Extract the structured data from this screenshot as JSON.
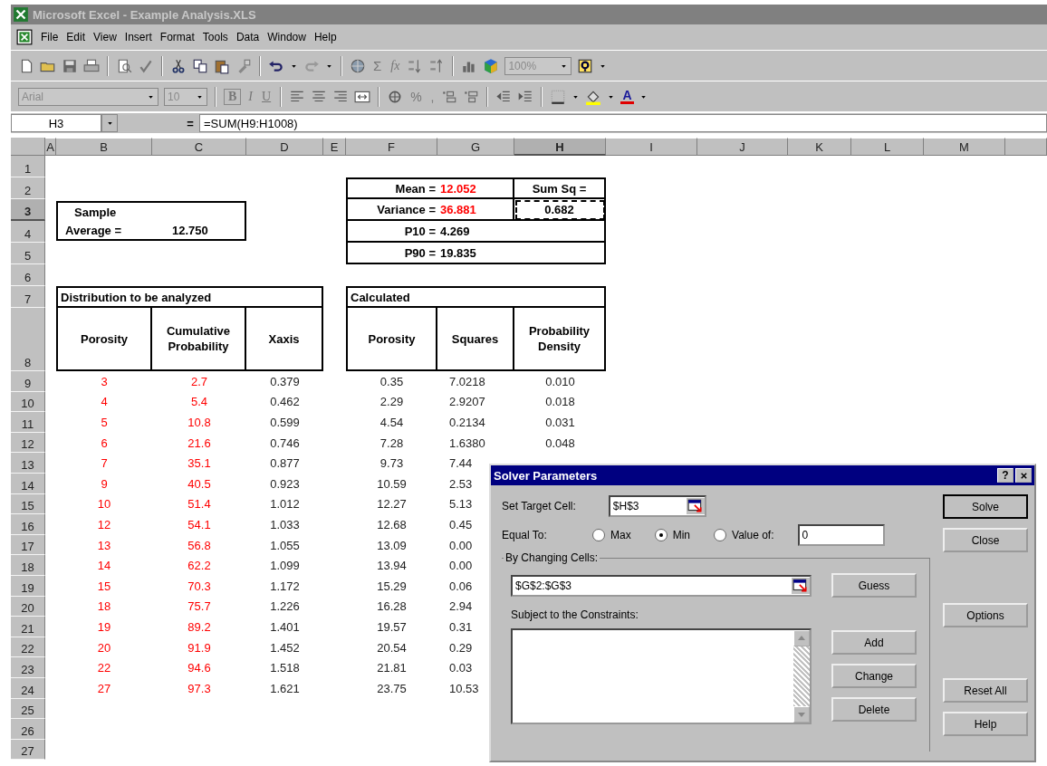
{
  "window": {
    "title": "Microsoft Excel - Example Analysis.XLS"
  },
  "menu": [
    "File",
    "Edit",
    "View",
    "Insert",
    "Format",
    "Tools",
    "Data",
    "Window",
    "Help"
  ],
  "standard_toolbar": {
    "disabled": true,
    "autosum": "Σ",
    "function": "fx",
    "zoom": "100%"
  },
  "formatting_toolbar": {
    "disabled": true,
    "font": "Arial",
    "size": "10",
    "bold": "B",
    "italic": "I",
    "underline": "U",
    "percent": "%",
    "comma": ",",
    "font_color": "A"
  },
  "formula_bar": {
    "name_box": "H3",
    "equals": "=",
    "formula": "=SUM(H9:H1008)"
  },
  "sheet": {
    "columns": [
      {
        "label": "A",
        "selected": false
      },
      {
        "label": "B",
        "selected": false
      },
      {
        "label": "C",
        "selected": false
      },
      {
        "label": "D",
        "selected": false
      },
      {
        "label": "E",
        "selected": false
      },
      {
        "label": "F",
        "selected": false
      },
      {
        "label": "G",
        "selected": false
      },
      {
        "label": "H",
        "selected": true
      },
      {
        "label": "I",
        "selected": false
      },
      {
        "label": "J",
        "selected": false
      },
      {
        "label": "K",
        "selected": false
      },
      {
        "label": "L",
        "selected": false
      },
      {
        "label": "M",
        "selected": false
      }
    ],
    "rows": [
      {
        "label": "1",
        "selected": false
      },
      {
        "label": "2",
        "selected": false
      },
      {
        "label": "3",
        "selected": true
      },
      {
        "label": "4",
        "selected": false
      },
      {
        "label": "5",
        "selected": false
      },
      {
        "label": "6",
        "selected": false
      },
      {
        "label": "7",
        "selected": false
      },
      {
        "label": "8",
        "selected": false
      },
      {
        "label": "9",
        "selected": false
      },
      {
        "label": "10",
        "selected": false
      },
      {
        "label": "11",
        "selected": false
      },
      {
        "label": "12",
        "selected": false
      },
      {
        "label": "13",
        "selected": false
      },
      {
        "label": "14",
        "selected": false
      },
      {
        "label": "15",
        "selected": false
      },
      {
        "label": "16",
        "selected": false
      },
      {
        "label": "17",
        "selected": false
      },
      {
        "label": "18",
        "selected": false
      },
      {
        "label": "19",
        "selected": false
      },
      {
        "label": "20",
        "selected": false
      },
      {
        "label": "21",
        "selected": false
      },
      {
        "label": "22",
        "selected": false
      },
      {
        "label": "23",
        "selected": false
      },
      {
        "label": "24",
        "selected": false
      },
      {
        "label": "25",
        "selected": false
      },
      {
        "label": "26",
        "selected": false
      },
      {
        "label": "27",
        "selected": false
      }
    ],
    "sample_box": {
      "title": "Sample",
      "label": "Average =",
      "value": "12.750"
    },
    "stats": [
      {
        "label": "Mean =",
        "value": "12.052",
        "highlight": true
      },
      {
        "label": "Variance =",
        "value": "36.881",
        "highlight": true
      },
      {
        "label": "P10 =",
        "value": "4.269",
        "highlight": false
      },
      {
        "label": "P90 =",
        "value": "19.835",
        "highlight": false
      }
    ],
    "sum_sq": {
      "label": "Sum Sq =",
      "value": "0.682",
      "active": true
    },
    "distribution": {
      "title": "Distribution to be analyzed",
      "columns": [
        {
          "label": "Porosity",
          "input": true
        },
        {
          "label": "Cumulative Probability",
          "input": true
        },
        {
          "label": "Xaxis",
          "input": false
        }
      ],
      "rows": [
        [
          "3",
          "2.7",
          "0.379"
        ],
        [
          "4",
          "5.4",
          "0.462"
        ],
        [
          "5",
          "10.8",
          "0.599"
        ],
        [
          "6",
          "21.6",
          "0.746"
        ],
        [
          "7",
          "35.1",
          "0.877"
        ],
        [
          "9",
          "40.5",
          "0.923"
        ],
        [
          "10",
          "51.4",
          "1.012"
        ],
        [
          "12",
          "54.1",
          "1.033"
        ],
        [
          "13",
          "56.8",
          "1.055"
        ],
        [
          "14",
          "62.2",
          "1.099"
        ],
        [
          "15",
          "70.3",
          "1.172"
        ],
        [
          "18",
          "75.7",
          "1.226"
        ],
        [
          "19",
          "89.2",
          "1.401"
        ],
        [
          "20",
          "91.9",
          "1.452"
        ],
        [
          "22",
          "94.6",
          "1.518"
        ],
        [
          "27",
          "97.3",
          "1.621"
        ]
      ]
    },
    "calculated": {
      "title": "Calculated",
      "columns": [
        {
          "label": "Porosity",
          "input": false
        },
        {
          "label": "Squares",
          "input": false
        },
        {
          "label": "Probability Density",
          "input": false
        }
      ],
      "rows": [
        [
          "0.35",
          "7.0218",
          "0.010"
        ],
        [
          "2.29",
          "2.9207",
          "0.018"
        ],
        [
          "4.54",
          "0.2134",
          "0.031"
        ],
        [
          "7.28",
          "1.6380",
          "0.048"
        ],
        [
          "9.73",
          "7.44"
        ],
        [
          "10.59",
          "2.53"
        ],
        [
          "12.27",
          "5.13"
        ],
        [
          "12.68",
          "0.45"
        ],
        [
          "13.09",
          "0.00"
        ],
        [
          "13.94",
          "0.00"
        ],
        [
          "15.29",
          "0.06"
        ],
        [
          "16.28",
          "2.94"
        ],
        [
          "19.57",
          "0.31"
        ],
        [
          "20.54",
          "0.29"
        ],
        [
          "21.81",
          "0.03"
        ],
        [
          "23.75",
          "10.53"
        ]
      ]
    }
  },
  "dialog": {
    "title": "Solver Parameters",
    "help_button": "?",
    "target": {
      "label": "Set Target Cell:",
      "value": "$H$3"
    },
    "equal_to": {
      "label": "Equal To:",
      "options": [
        {
          "label": "Max",
          "selected": false
        },
        {
          "label": "Min",
          "selected": true
        },
        {
          "label": "Value of:",
          "selected": false
        }
      ],
      "value": "0"
    },
    "changing": {
      "label": "By Changing Cells:",
      "value": "$G$2:$G$3",
      "button": "Guess"
    },
    "constraints": {
      "label": "Subject to the Constraints:",
      "buttons": [
        "Add",
        "Change",
        "Delete"
      ]
    },
    "side_buttons": [
      {
        "label": "Solve",
        "default": true
      },
      {
        "label": "Close",
        "default": false
      },
      {
        "label": "Options",
        "default": false
      },
      {
        "label": "Reset All",
        "default": false
      },
      {
        "label": "Help",
        "default": false
      }
    ]
  }
}
